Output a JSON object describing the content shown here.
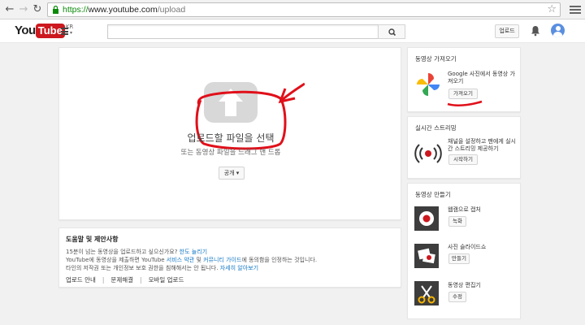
{
  "browser": {
    "url_scheme": "https://",
    "url_host": "www.youtube.com",
    "url_path": "/upload"
  },
  "header": {
    "logo_you": "You",
    "logo_tube": "Tube",
    "logo_region": "KR",
    "upload_button": "업로드"
  },
  "upload": {
    "select_file": "업로드할 파일을 선택",
    "drag_hint": "또는 동영상 파일을 드래그 앤 드롭",
    "privacy_button": "공개 ▾"
  },
  "help": {
    "title": "도움말 및 제안사항",
    "line1_text": "15분이 넘는 동영상을 업로드하고 싶으신가요? ",
    "line1_link": "한도 늘리기",
    "line2_a": "YouTube에 동영상을 제출하면 YouTube ",
    "line2_link1": "서비스 약관",
    "line2_b": " 및 ",
    "line2_link2": "커뮤니티 가이드",
    "line2_c": "에 동의함을 인정하는 것입니다.",
    "line3_text": "타인의 저작권 또는 개인정보 보호 권한을 침해해서는 안 됩니다. ",
    "line3_link": "자세히 알아보기",
    "links": [
      "업로드 안내",
      "문제해결",
      "모바일 업로드"
    ]
  },
  "import_panel": {
    "title": "동영상 가져오기",
    "text": "Google 사진에서 동영상 가져오기",
    "button": "가져오기"
  },
  "live_panel": {
    "title": "실시간 스트리밍",
    "text": "채널을 설정하고 팬에게 실시간 스트리밍 제공하기",
    "button": "시작하기"
  },
  "create_panel": {
    "title": "동영상 만들기",
    "tools": [
      {
        "title": "웹캠으로 캡처",
        "button": "녹화"
      },
      {
        "title": "사진 슬라이드쇼",
        "button": "만들기"
      },
      {
        "title": "동영상 편집기",
        "button": "수정"
      }
    ]
  },
  "colors": {
    "brand_red": "#cc181e",
    "link_blue": "#167ac6",
    "annotation_red": "#e0101a"
  }
}
